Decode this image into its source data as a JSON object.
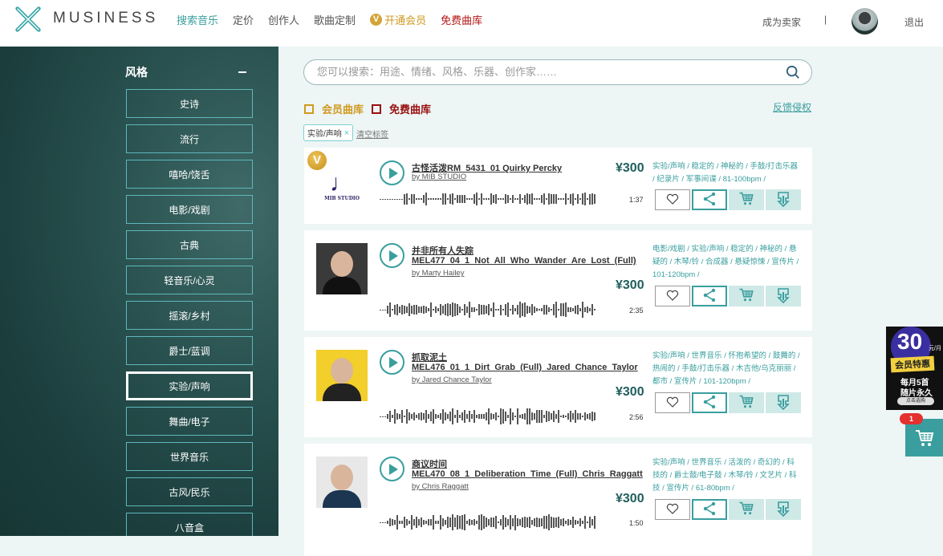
{
  "header": {
    "brand": "MUSINESS",
    "nav": [
      {
        "label": "搜索音乐"
      },
      {
        "label": "定价"
      },
      {
        "label": "创作人"
      },
      {
        "label": "歌曲定制"
      },
      {
        "label": "开通会员",
        "badge": "V"
      },
      {
        "label": "免费曲库"
      }
    ],
    "seller": "成为卖家",
    "separator": "|",
    "logout": "退出"
  },
  "sidebar": {
    "title": "风格",
    "styles": [
      "史诗",
      "流行",
      "嘻哈/饶舌",
      "电影/戏剧",
      "古典",
      "轻音乐/心灵",
      "摇滚/乡村",
      "爵士/蓝调",
      "实验/声响",
      "舞曲/电子",
      "世界音乐",
      "古风/民乐",
      "八音盒"
    ],
    "selected": "实验/声响"
  },
  "search": {
    "placeholder": "您可以搜索：用途、情绪、风格、乐器、创作家……"
  },
  "filters": {
    "member": "会员曲库",
    "free": "免费曲库",
    "feedback": "反馈侵权"
  },
  "active_tag": {
    "label": "实验/声响",
    "remove": "×",
    "clear": "清空标签"
  },
  "colors": {
    "accent": "#3a9e9e",
    "vip": "#d09a1e",
    "free": "#b51414",
    "price": "#1f5e5c"
  },
  "tracks": [
    {
      "vip": "V",
      "cover_text": "MIB STUDIO",
      "title": "古怪活泼RM_5431_01 Quirky Percky",
      "subtitle": "",
      "by": "by MIB STUDIO",
      "price": "¥300",
      "tags": "实验/声响 / 稳定的 / 神秘的 / 手鼓/打击乐器 / 纪录片 / 军事间谍 / 81-100bpm /",
      "duration": "1:37"
    },
    {
      "title": "并非所有人失踪",
      "subtitle": "MEL477_04_1_Not_All_Who_Wander_Are_Lost_(Full)",
      "by": "by Marty Hailey",
      "price": "¥300",
      "tags": "电影/戏剧 / 实验/声响 / 稳定的 / 神秘的 / 悬疑的 / 木琴/铃 / 合成器 / 悬疑惊悚 / 宣传片 / 101-120bpm /",
      "duration": "2:35"
    },
    {
      "title": "抓取泥土",
      "subtitle": "MEL476_01_1_Dirt_Grab_(Full)_Jared_Chance_Taylor",
      "by": "by Jared Chance Taylor",
      "price": "¥300",
      "tags": "实验/声响 / 世界音乐 / 怀抱希望的 / 鼓舞的 / 热闹的 / 手鼓/打击乐器 / 木吉他/乌克丽丽 / 都市 / 宣传片 / 101-120bpm /",
      "duration": "2:56"
    },
    {
      "title": "商议时间",
      "subtitle": "MEL470_08_1_Deliberation_Time_(Full)_Chris_Raggatt",
      "by": "by Chris Raggatt",
      "price": "¥300",
      "tags": "实验/声响 / 世界音乐 / 活泼的 / 奇幻的 / 科技的 / 爵士鼓/电子鼓 / 木琴/铃 / 文艺片 / 科技 / 宣传片 / 61-80bpm /",
      "duration": "1:50"
    }
  ],
  "promo": {
    "price": "30",
    "unit": "元/月",
    "banner": "会员特惠",
    "line1": "每月5首",
    "line2": "随片永久",
    "button": "点击选购"
  },
  "cart": {
    "count": "1"
  }
}
